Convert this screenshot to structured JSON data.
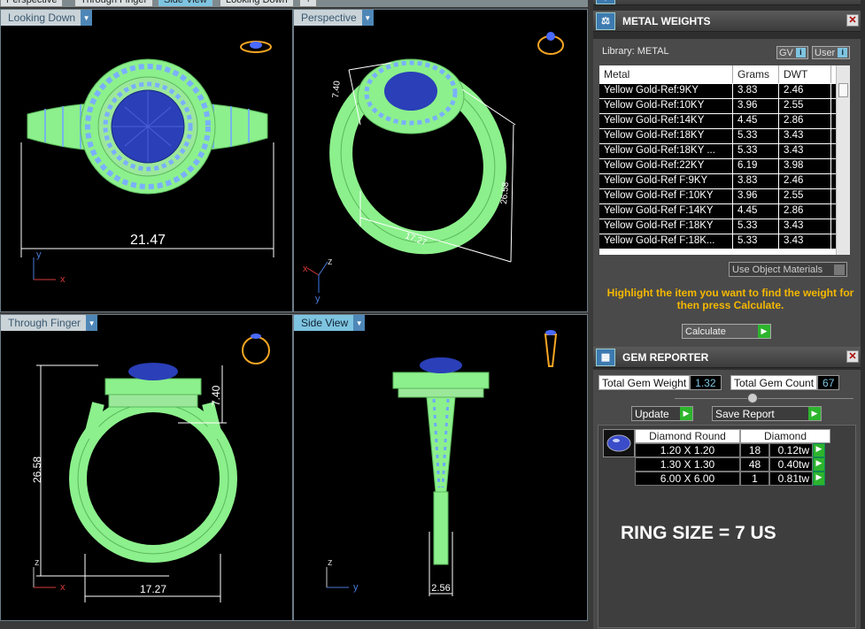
{
  "tabs": [
    "Perspective",
    "Through Finger",
    "Side View",
    "Looking Down",
    "+"
  ],
  "viewports": {
    "looking_down": {
      "label": "Looking Down",
      "dimension": "21.47",
      "axis_x": "x",
      "axis_y": "y"
    },
    "perspective": {
      "label": "Perspective",
      "dim_a": "7.40",
      "dim_b": "26.58",
      "dim_c": "17.27",
      "axis_x": "x",
      "axis_y": "y",
      "axis_z": "z"
    },
    "through_finger": {
      "label": "Through Finger",
      "dim_height": "26.58",
      "dim_head": "7.40",
      "dim_width": "17.27",
      "axis_x": "x",
      "axis_z": "z"
    },
    "side_view": {
      "label": "Side View",
      "dim_width": "2.56",
      "axis_y": "y",
      "axis_z": "z"
    }
  },
  "metal_weights": {
    "title": "METAL WEIGHTS",
    "library_label": "Library: METAL",
    "gv_label": "GV",
    "user_label": "User",
    "columns": [
      "Metal",
      "Grams",
      "DWT"
    ],
    "rows": [
      [
        "Yellow Gold-Ref:9KY",
        "3.83",
        "2.46"
      ],
      [
        "Yellow Gold-Ref:10KY",
        "3.96",
        "2.55"
      ],
      [
        "Yellow Gold-Ref:14KY",
        "4.45",
        "2.86"
      ],
      [
        "Yellow Gold-Ref:18KY",
        "5.33",
        "3.43"
      ],
      [
        "Yellow Gold-Ref:18KY ...",
        "5.33",
        "3.43"
      ],
      [
        "Yellow Gold-Ref:22KY",
        "6.19",
        "3.98"
      ],
      [
        "Yellow Gold-Ref F:9KY",
        "3.83",
        "2.46"
      ],
      [
        "Yellow Gold-Ref F:10KY",
        "3.96",
        "2.55"
      ],
      [
        "Yellow Gold-Ref F:14KY",
        "4.45",
        "2.86"
      ],
      [
        "Yellow Gold-Ref F:18KY",
        "5.33",
        "3.43"
      ],
      [
        "Yellow Gold-Ref F:18K...",
        "5.33",
        "3.43"
      ]
    ],
    "use_object_materials": "Use Object Materials",
    "hint": "Highlight the item you want to find the weight for then press Calculate.",
    "calculate": "Calculate"
  },
  "gem_reporter": {
    "title": "GEM REPORTER",
    "total_weight_label": "Total Gem Weight",
    "total_weight": "1.32",
    "total_count_label": "Total Gem Count",
    "total_count": "67",
    "update": "Update",
    "save_report": "Save Report",
    "headers": [
      "Diamond Round",
      "Diamond"
    ],
    "rows": [
      [
        "1.20 X 1.20",
        "18",
        "0.12tw"
      ],
      [
        "1.30 X 1.30",
        "48",
        "0.40tw"
      ],
      [
        "6.00 X 6.00",
        "1",
        "0.81tw"
      ]
    ]
  },
  "ring_size": "RING SIZE = 7 US",
  "colors": {
    "metal_green": "#8cf08c",
    "stone_blue": "#2a3fb8",
    "viewport_bg": "#000000",
    "accent": "#7ec4e0",
    "hint": "#f5b800"
  }
}
